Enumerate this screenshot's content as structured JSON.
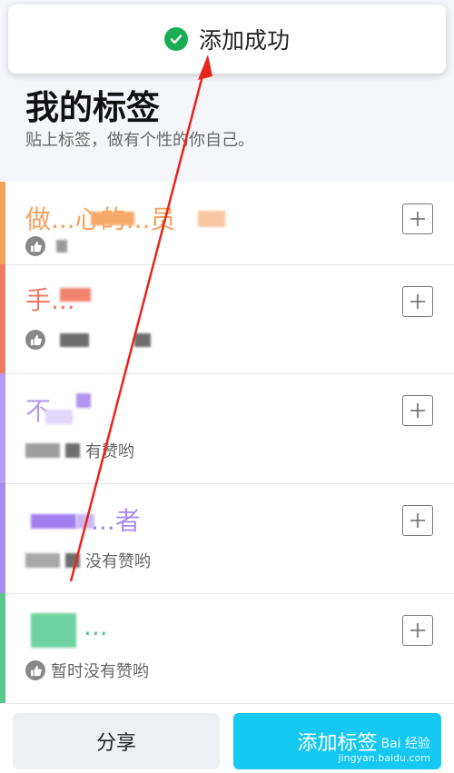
{
  "toast": {
    "text": "添加成功"
  },
  "header": {
    "title": "我的标签",
    "subtitle": "贴上标签，做有个性的你自己。"
  },
  "tags": [
    {
      "name": "做...心的...员",
      "likes": "",
      "color": "#f2a25d"
    },
    {
      "name": "手...",
      "likes": "",
      "color": "#ef7a66"
    },
    {
      "name": "不...",
      "likes": "有赞哟",
      "color": "#b69cf0"
    },
    {
      "name": "...者",
      "likes": "没有赞哟",
      "color": "#a78bed"
    },
    {
      "name": "...",
      "likes": "暂时没有赞哟",
      "color": "#57c98f"
    }
  ],
  "footer": {
    "share_label": "分享",
    "add_label": "添加标签",
    "watermark_line1": "Bai 经验",
    "watermark_line2": "jingyan.baidu.com"
  },
  "icons": {
    "toast_icon": "check-circle-icon",
    "like_icon": "thumb-up-icon",
    "add_icon": "plus-icon"
  },
  "colors": {
    "accent": "#15c8f1",
    "success": "#1aad52",
    "annotation": "#e8241c"
  }
}
